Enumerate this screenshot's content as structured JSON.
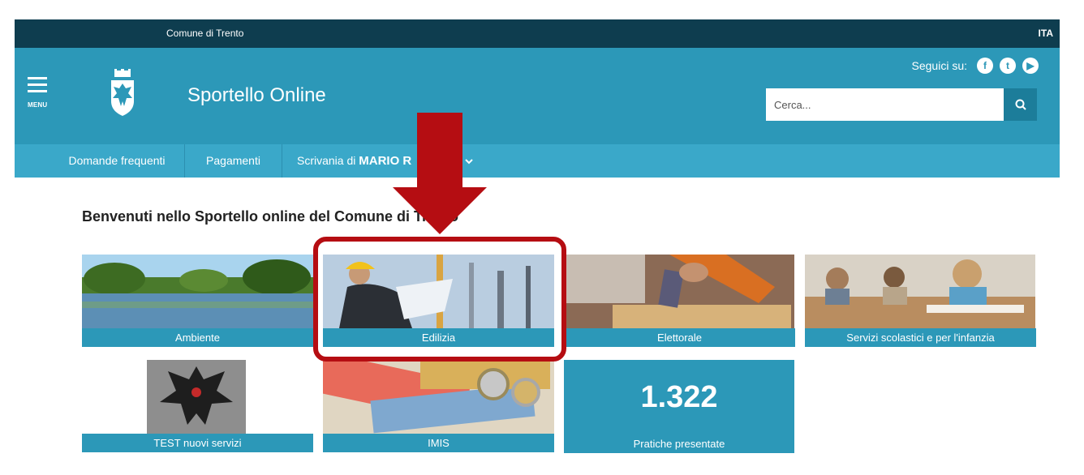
{
  "topbar": {
    "city": "Comune di Trento",
    "lang": "ITA"
  },
  "header": {
    "menu_label": "MENU",
    "site_title": "Sportello Online",
    "follow_label": "Seguici su:",
    "social": [
      {
        "icon": "facebook-icon",
        "glyph": "f"
      },
      {
        "icon": "twitter-icon",
        "glyph": "t"
      },
      {
        "icon": "youtube-icon",
        "glyph": "▶"
      }
    ],
    "search_placeholder": "Cerca..."
  },
  "nav": {
    "faq": "Domande frequenti",
    "payments": "Pagamenti",
    "desk_prefix": "Scrivania di",
    "desk_user": "MARIO R"
  },
  "main": {
    "welcome": "Benvenuti nello Sportello online del Comune di Trento",
    "tiles": [
      {
        "label": "Ambiente"
      },
      {
        "label": "Edilizia"
      },
      {
        "label": "Elettorale"
      },
      {
        "label": "Servizi scolastici e per l'infanzia"
      },
      {
        "label": "TEST nuovi servizi"
      },
      {
        "label": "IMIS"
      }
    ],
    "stat": {
      "value": "1.322",
      "label": "Pratiche presentate"
    }
  },
  "colors": {
    "dark": "#0e3d4f",
    "primary": "#2c98b8",
    "nav": "#3aa8c9",
    "highlight": "#b50d12"
  }
}
